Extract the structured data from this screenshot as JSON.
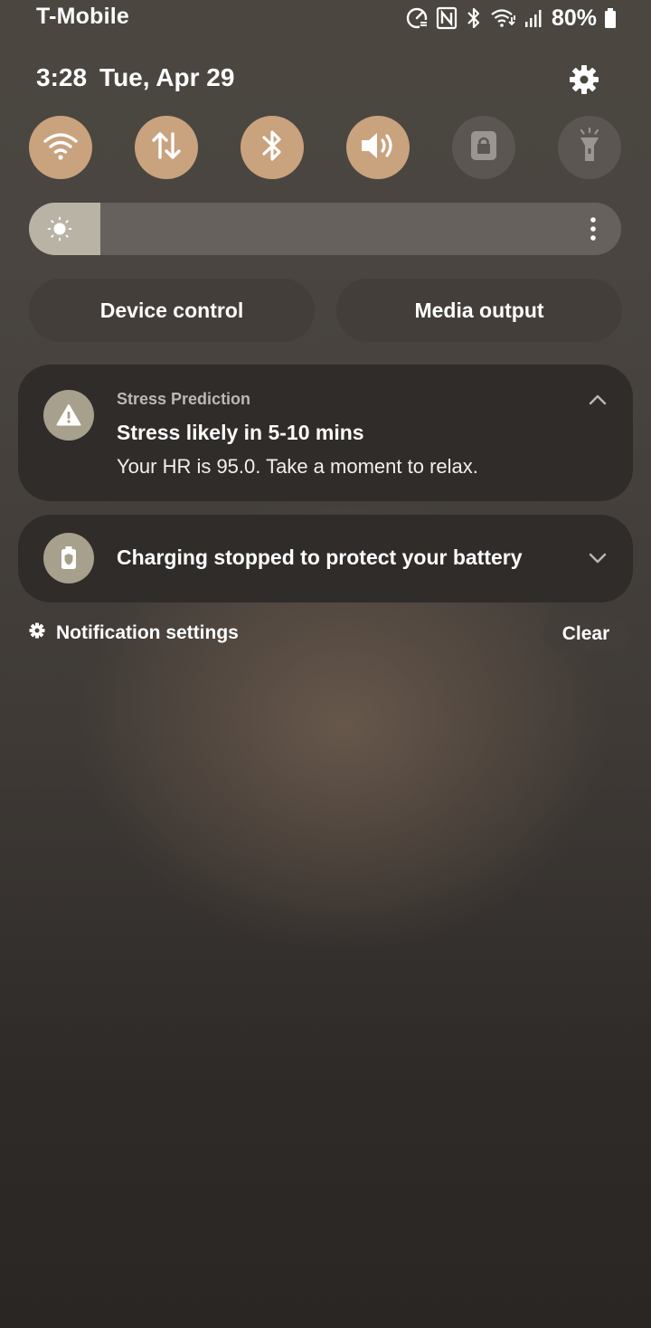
{
  "status_bar": {
    "carrier": "T-Mobile",
    "battery_percent": "80%",
    "icons": [
      "data-saver-icon",
      "nfc-icon",
      "bluetooth-icon",
      "wifi-icon",
      "signal-icon",
      "battery-icon"
    ]
  },
  "header": {
    "time": "3:28",
    "date": "Tue, Apr 29"
  },
  "quick_toggles": [
    {
      "name": "wifi-icon",
      "state": "on"
    },
    {
      "name": "mobile-data-icon",
      "state": "on"
    },
    {
      "name": "bluetooth-icon",
      "state": "on"
    },
    {
      "name": "sound-icon",
      "state": "on"
    },
    {
      "name": "lock-rotation-icon",
      "state": "off"
    },
    {
      "name": "flashlight-icon",
      "state": "off"
    }
  ],
  "brightness": {
    "level": 0.12
  },
  "buttons": {
    "device_control": "Device control",
    "media_output": "Media output"
  },
  "notifications": [
    {
      "app": "Stress Prediction",
      "title": "Stress likely in 5-10 mins",
      "text": "Your HR is 95.0. Take a moment to relax.",
      "icon": "warning-icon",
      "expanded": true
    },
    {
      "title": "Charging stopped to protect your battery",
      "icon": "battery-protect-icon",
      "expanded": false
    }
  ],
  "footer": {
    "settings_label": "Notification settings",
    "clear_label": "Clear"
  },
  "colors": {
    "toggle_on": "#c9a27e",
    "toggle_off": "#5b5652",
    "card_bg": "#2f2c2a"
  }
}
